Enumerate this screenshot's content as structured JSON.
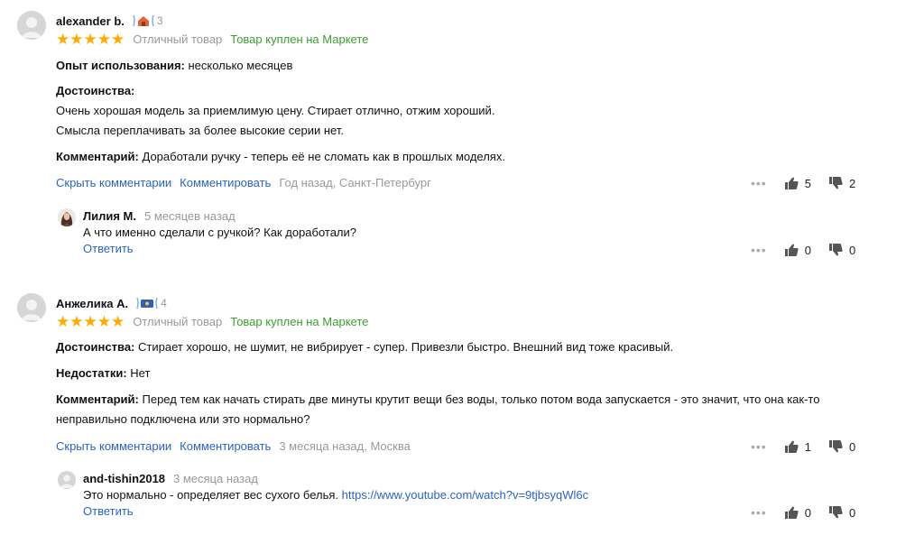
{
  "reviews": [
    {
      "author": "alexander b.",
      "badge_count": "3",
      "stars": "★★★★★",
      "grade": "Отличный товар",
      "bought": "Товар куплен на Маркете",
      "usage_label": "Опыт использования:",
      "usage_value": "несколько месяцев",
      "pros_label": "Достоинства:",
      "pros_line1": "Очень хорошая модель за приемлимую цену. Стирает отлично, отжим хороший.",
      "pros_line2": "Смысла переплачивать за более высокие серии нет.",
      "comment_label": "Комментарий:",
      "comment_value": "Доработали ручку - теперь её не сломать как в прошлых моделях.",
      "hide_comments": "Скрыть комментарии",
      "add_comment": "Комментировать",
      "meta": "Год назад, Санкт-Петербург",
      "likes": "5",
      "dislikes": "2",
      "reply": {
        "author": "Лилия М.",
        "time": "5 месяцев назад",
        "text": "А что именно сделали с ручкой? Как доработали?",
        "answer": "Ответить",
        "likes": "0",
        "dislikes": "0"
      }
    },
    {
      "author": "Анжелика А.",
      "badge_count": "4",
      "stars": "★★★★★",
      "grade": "Отличный товар",
      "bought": "Товар куплен на Маркете",
      "pros_label": "Достоинства:",
      "pros_value": "Стирает хорошо, не шумит, не вибрирует - супер. Привезли быстро. Внешний вид тоже красивый.",
      "cons_label": "Недостатки:",
      "cons_value": "Нет",
      "comment_label": "Комментарий:",
      "comment_line1": "Перед тем как начать стирать две минуты крутит вещи без воды, только потом вода запускается - это значит, что она как-то",
      "comment_line2": "неправильно подключена или это нормально?",
      "hide_comments": "Скрыть комментарии",
      "add_comment": "Комментировать",
      "meta": "3 месяца назад, Москва",
      "likes": "1",
      "dislikes": "0",
      "reply": {
        "author": "and-tishin2018",
        "time": "3 месяца назад",
        "text": "Это нормально - определяет вес сухого белья.",
        "link": "https://www.youtube.com/watch?v=9tjbsyqWl6c",
        "answer": "Ответить",
        "likes": "0",
        "dislikes": "0"
      }
    }
  ],
  "more_dots": "•••",
  "colors": {
    "star": "#ffaa00",
    "link": "#2b63c2",
    "bought": "#3b9e2f",
    "meta": "#999999"
  }
}
